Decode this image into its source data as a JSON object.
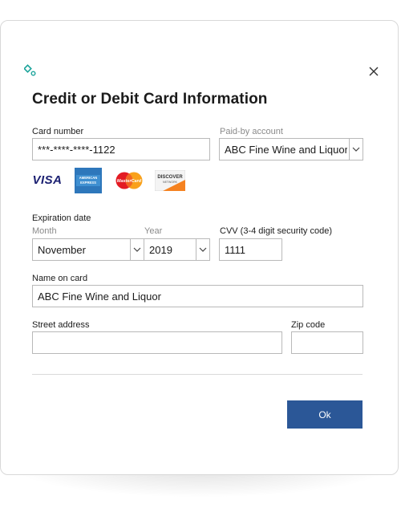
{
  "dialog": {
    "title": "Credit or Debit Card Information",
    "close_icon": "close-icon",
    "app_icon": "payment-app-icon"
  },
  "card_number": {
    "label": "Card number",
    "value": "***-****-****-1122"
  },
  "paid_by": {
    "label": "Paid-by account",
    "value": "ABC Fine Wine and Liquor"
  },
  "card_logos": {
    "visa_text": "VISA",
    "amex_text": "AMERICAN EXPRESS",
    "discover_text": "DISCOVER",
    "discover_sub": "NETWORK",
    "mastercard_text": "MasterCard"
  },
  "expiration": {
    "label": "Expiration date",
    "month_label": "Month",
    "year_label": "Year",
    "month_value": "November",
    "year_value": "2019"
  },
  "cvv": {
    "label": "CVV (3-4 digit security code)",
    "value": "1111"
  },
  "name_on_card": {
    "label": "Name on card",
    "value": "ABC Fine Wine and Liquor"
  },
  "street_address": {
    "label": "Street address",
    "value": ""
  },
  "zip_code": {
    "label": "Zip code",
    "value": ""
  },
  "actions": {
    "ok_label": "Ok"
  },
  "colors": {
    "accent": "#2b5797",
    "border": "#b9b9b9",
    "muted_label": "#8a8a8a",
    "app_icon": "#1aa39a"
  }
}
